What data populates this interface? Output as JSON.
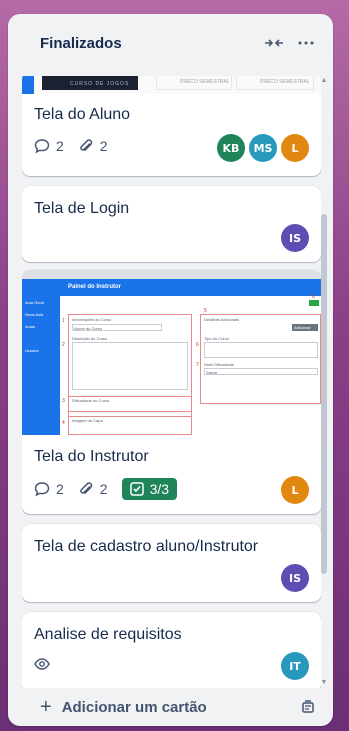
{
  "list": {
    "title": "Finalizados",
    "collapse_icon": "collapse-horizontal-icon",
    "menu_icon": "more-horizontal-icon",
    "footer": {
      "add_label": "Adicionar um cartão",
      "template_icon": "card-template-icon"
    }
  },
  "cards": [
    {
      "title": "Tela do Aluno",
      "cover_texts": [
        "CURSO DE JOGOS",
        "PRECO SEMESTRAL",
        "PRECO SEMESTRAL"
      ],
      "comments": "2",
      "attachments": "2",
      "members": [
        {
          "initials": "KB",
          "color": "#1f845a"
        },
        {
          "initials": "MS",
          "color": "#2898bd"
        },
        {
          "initials": "L",
          "color": "#e2870f"
        }
      ]
    },
    {
      "title": "Tela de Login",
      "members": [
        {
          "initials": "IS",
          "color": "#5e4db2"
        }
      ]
    },
    {
      "title": "Tela do Instrutor",
      "cover": {
        "app_title": "Painel do Instrutor",
        "sidebar_items": [
          "Aula Geral",
          "Nova Aula",
          "Aulas",
          "Usuário"
        ],
        "sections": [
          "Informações do Curso",
          "Detalhes Adicionais",
          "Nome do Curso",
          "Descrição do Curso",
          "Dificuldade do Curso",
          "Imagem da Capa",
          "Tipo do Curso",
          "Nível Dificuldade",
          "Adicionar",
          "Salvar"
        ],
        "numbers": [
          "1",
          "2",
          "3",
          "4",
          "5",
          "6",
          "7",
          "8"
        ]
      },
      "comments": "2",
      "attachments": "2",
      "checklist": "3/3",
      "members": [
        {
          "initials": "L",
          "color": "#e2870f"
        }
      ]
    },
    {
      "title": "Tela de cadastro aluno/Instrutor",
      "members": [
        {
          "initials": "IS",
          "color": "#5e4db2"
        }
      ]
    },
    {
      "title": "Analise de requisitos",
      "watch_icon": "eye-icon",
      "members": [
        {
          "initials": "IT",
          "color": "#2898bd"
        }
      ]
    }
  ],
  "colors": {
    "list_bg": "#f1f2f4",
    "text": "#172b4d",
    "checklist_done": "#1f845a",
    "board_bg": "#8a3f86"
  }
}
